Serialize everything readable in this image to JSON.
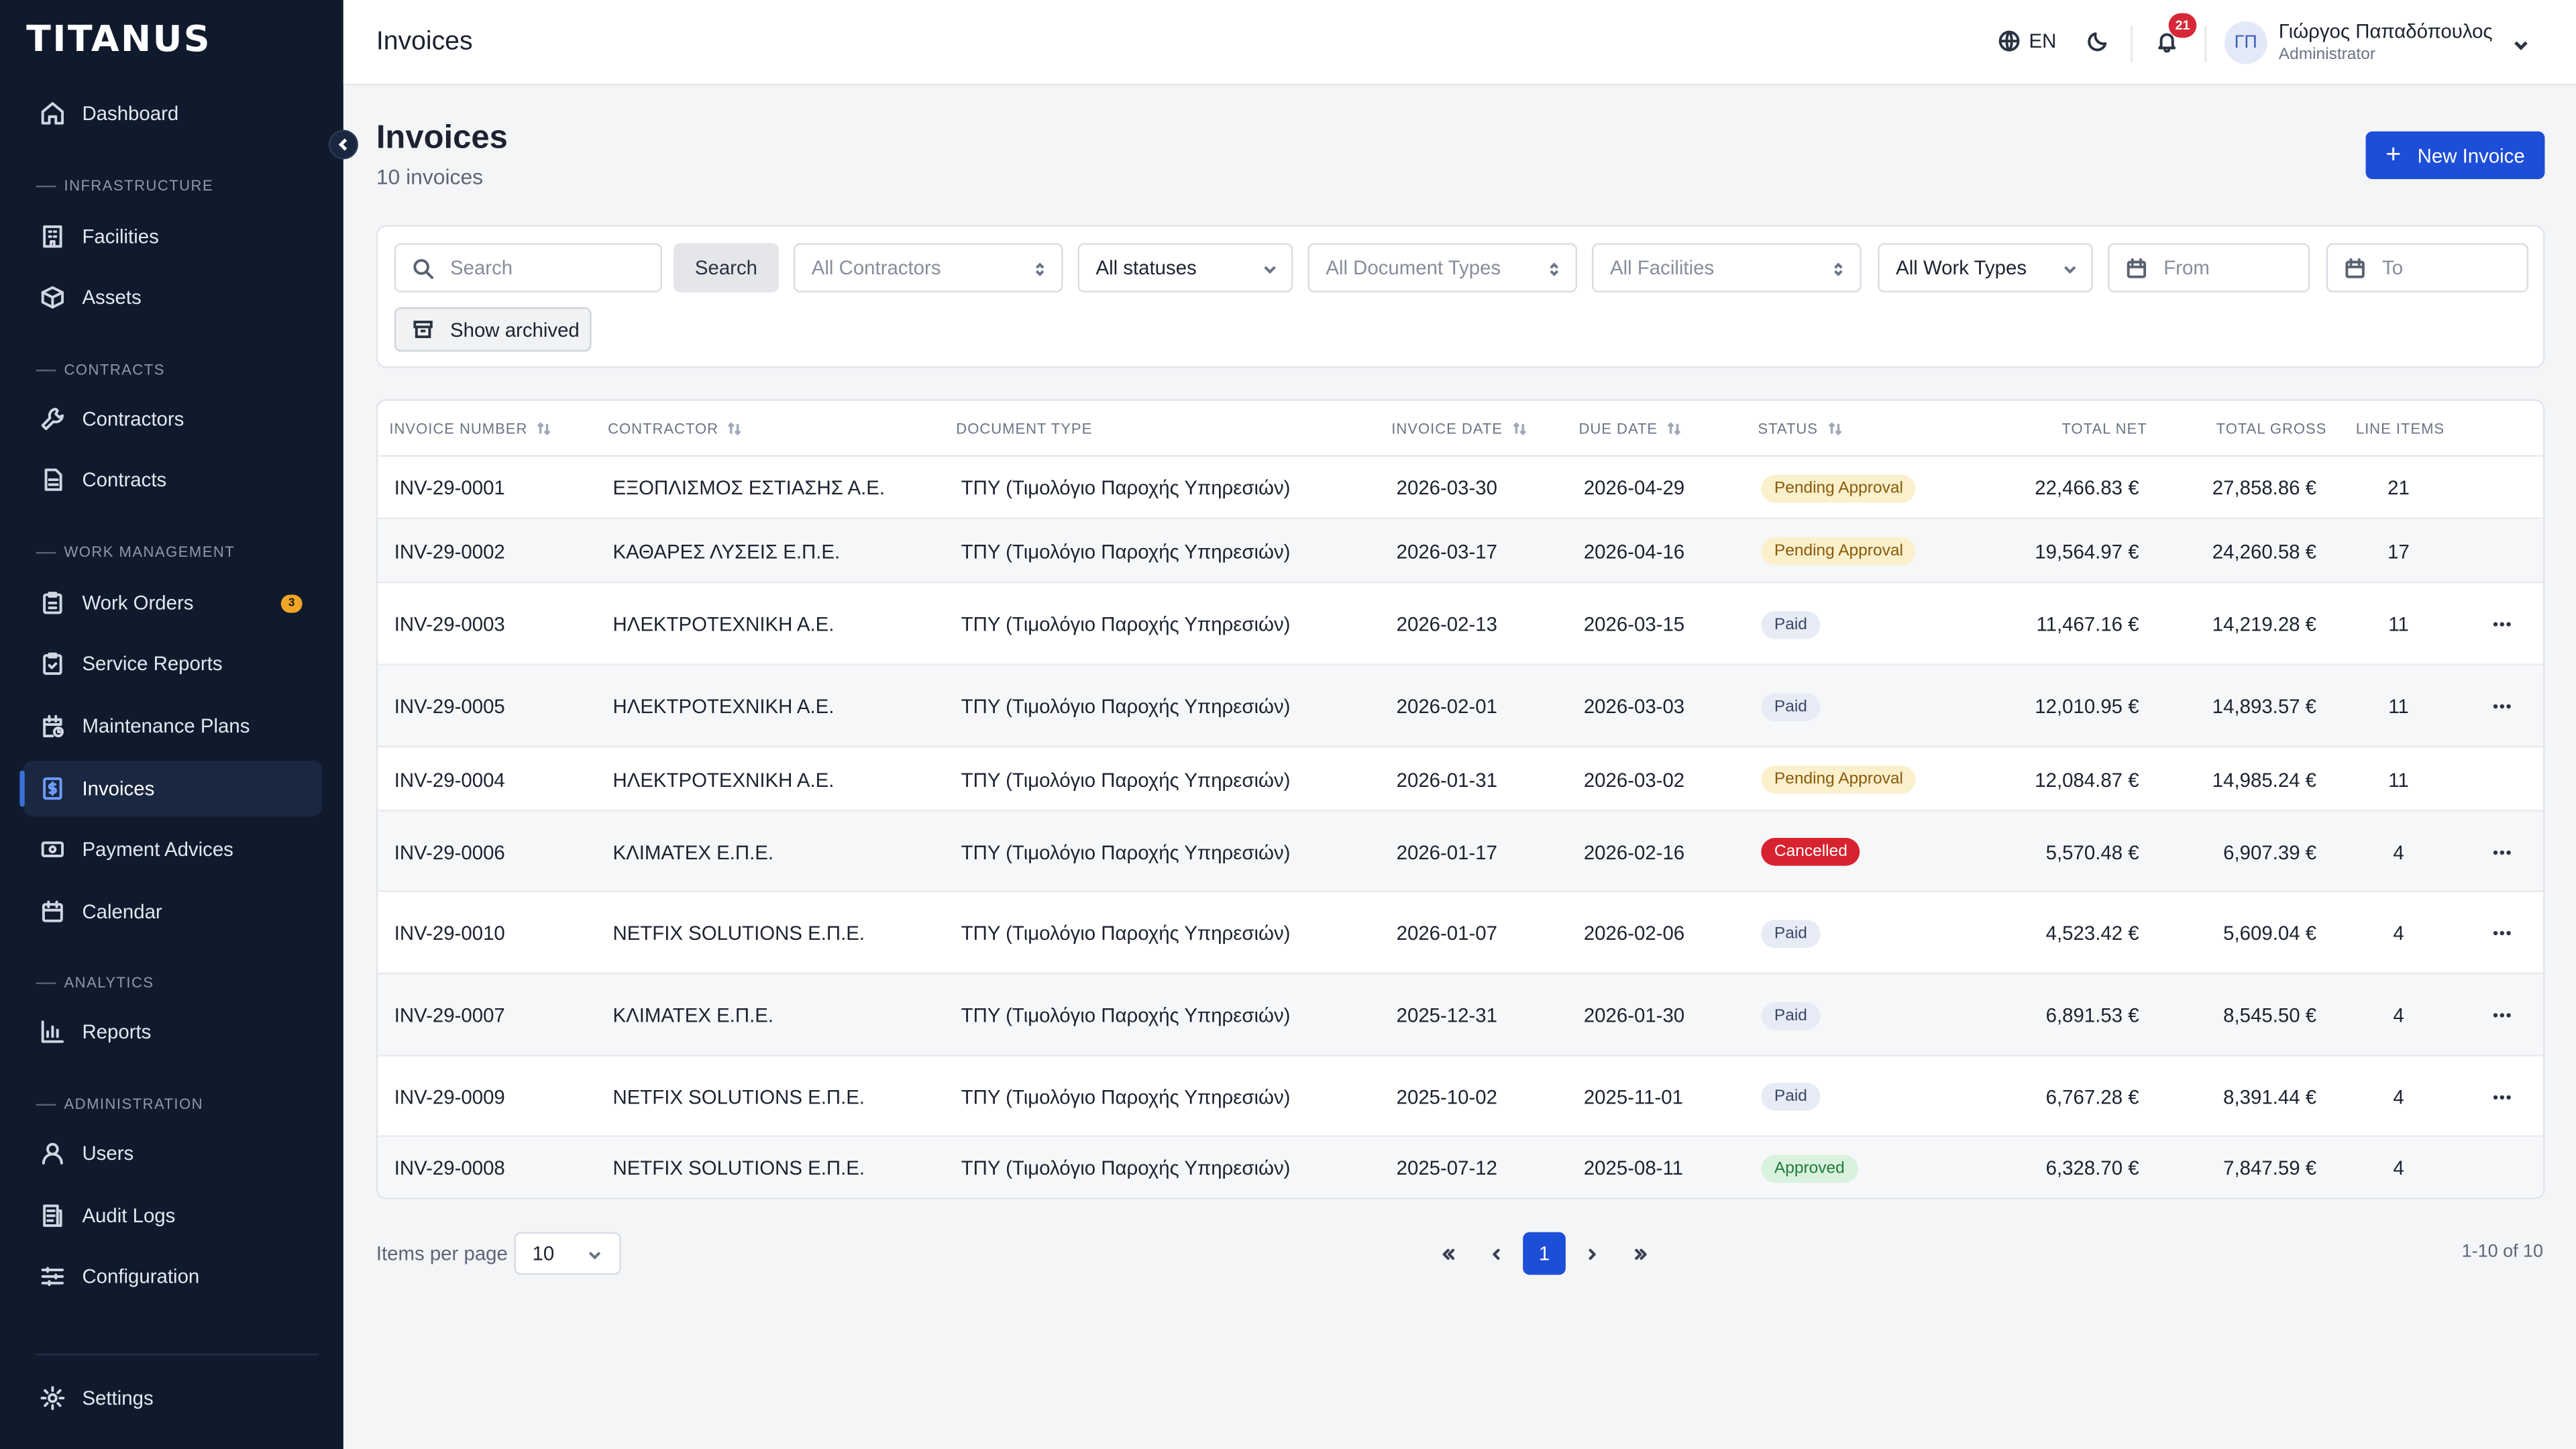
{
  "app": {
    "brand": "TITANUS"
  },
  "sidebar": {
    "items": [
      {
        "label": "Dashboard",
        "icon": "home-icon"
      },
      {
        "section": "INFRASTRUCTURE"
      },
      {
        "label": "Facilities",
        "icon": "building-icon"
      },
      {
        "label": "Assets",
        "icon": "box-icon"
      },
      {
        "section": "CONTRACTS"
      },
      {
        "label": "Contractors",
        "icon": "wrench-icon"
      },
      {
        "label": "Contracts",
        "icon": "document-icon"
      },
      {
        "section": "WORK MANAGEMENT"
      },
      {
        "label": "Work Orders",
        "icon": "clipboard-icon",
        "badge": "3"
      },
      {
        "label": "Service Reports",
        "icon": "clipboard-check-icon"
      },
      {
        "label": "Maintenance Plans",
        "icon": "calendar-clock-icon"
      },
      {
        "label": "Invoices",
        "icon": "invoice-icon",
        "active": true
      },
      {
        "label": "Payment Advices",
        "icon": "banknote-icon"
      },
      {
        "label": "Calendar",
        "icon": "calendar-icon"
      },
      {
        "section": "ANALYTICS"
      },
      {
        "label": "Reports",
        "icon": "bar-chart-icon"
      },
      {
        "section": "ADMINISTRATION"
      },
      {
        "label": "Users",
        "icon": "user-icon"
      },
      {
        "label": "Audit Logs",
        "icon": "logs-icon"
      },
      {
        "label": "Configuration",
        "icon": "sliders-icon"
      },
      {
        "label": "Settings",
        "icon": "gear-icon"
      }
    ]
  },
  "topbar": {
    "title": "Invoices",
    "language": "EN",
    "notifications": "21",
    "user": {
      "initials": "ΓΠ",
      "name": "Γιώργος Παπαδόπουλος",
      "role": "Administrator"
    }
  },
  "header": {
    "title": "Invoices",
    "subtitle": "10 invoices",
    "new_button": "New Invoice"
  },
  "filters": {
    "search_placeholder": "Search",
    "search_button": "Search",
    "contractors": "All Contractors",
    "statuses": "All statuses",
    "document_types": "All Document Types",
    "facilities": "All Facilities",
    "work_types": "All Work Types",
    "from_placeholder": "From",
    "to_placeholder": "To",
    "show_archived": "Show archived"
  },
  "table": {
    "columns": [
      "INVOICE NUMBER",
      "CONTRACTOR",
      "DOCUMENT TYPE",
      "INVOICE DATE",
      "DUE DATE",
      "STATUS",
      "TOTAL NET",
      "TOTAL GROSS",
      "LINE ITEMS"
    ],
    "rows": [
      {
        "number": "INV-29-0001",
        "contractor": "ΕΞΟΠΛΙΣΜΟΣ ΕΣΤΙΑΣΗΣ Α.Ε.",
        "doc_type": "ΤΠΥ (Τιμολόγιο Παροχής Υπηρεσιών)",
        "invoice_date": "2026-03-30",
        "due_date": "2026-04-29",
        "status": "Pending Approval",
        "status_kind": "pending",
        "net": "22,466.83 €",
        "gross": "27,858.86 €",
        "items": "21",
        "menu": false
      },
      {
        "number": "INV-29-0002",
        "contractor": "ΚΑΘΑΡΕΣ ΛΥΣΕΙΣ Ε.Π.Ε.",
        "doc_type": "ΤΠΥ (Τιμολόγιο Παροχής Υπηρεσιών)",
        "invoice_date": "2026-03-17",
        "due_date": "2026-04-16",
        "status": "Pending Approval",
        "status_kind": "pending",
        "net": "19,564.97 €",
        "gross": "24,260.58 €",
        "items": "17",
        "menu": false
      },
      {
        "number": "INV-29-0003",
        "contractor": "ΗΛΕΚΤΡΟΤΕΧΝΙΚΗ Α.Ε.",
        "doc_type": "ΤΠΥ (Τιμολόγιο Παροχής Υπηρεσιών)",
        "invoice_date": "2026-02-13",
        "due_date": "2026-03-15",
        "status": "Paid",
        "status_kind": "paid",
        "net": "11,467.16 €",
        "gross": "14,219.28 €",
        "items": "11",
        "menu": true
      },
      {
        "number": "INV-29-0005",
        "contractor": "ΗΛΕΚΤΡΟΤΕΧΝΙΚΗ Α.Ε.",
        "doc_type": "ΤΠΥ (Τιμολόγιο Παροχής Υπηρεσιών)",
        "invoice_date": "2026-02-01",
        "due_date": "2026-03-03",
        "status": "Paid",
        "status_kind": "paid",
        "net": "12,010.95 €",
        "gross": "14,893.57 €",
        "items": "11",
        "menu": true
      },
      {
        "number": "INV-29-0004",
        "contractor": "ΗΛΕΚΤΡΟΤΕΧΝΙΚΗ Α.Ε.",
        "doc_type": "ΤΠΥ (Τιμολόγιο Παροχής Υπηρεσιών)",
        "invoice_date": "2026-01-31",
        "due_date": "2026-03-02",
        "status": "Pending Approval",
        "status_kind": "pending",
        "net": "12,084.87 €",
        "gross": "14,985.24 €",
        "items": "11",
        "menu": false
      },
      {
        "number": "INV-29-0006",
        "contractor": "ΚΛΙΜΑΤΕΧ Ε.Π.Ε.",
        "doc_type": "ΤΠΥ (Τιμολόγιο Παροχής Υπηρεσιών)",
        "invoice_date": "2026-01-17",
        "due_date": "2026-02-16",
        "status": "Cancelled",
        "status_kind": "cancelled",
        "net": "5,570.48 €",
        "gross": "6,907.39 €",
        "items": "4",
        "menu": true
      },
      {
        "number": "INV-29-0010",
        "contractor": "NETFIX SOLUTIONS Ε.Π.Ε.",
        "doc_type": "ΤΠΥ (Τιμολόγιο Παροχής Υπηρεσιών)",
        "invoice_date": "2026-01-07",
        "due_date": "2026-02-06",
        "status": "Paid",
        "status_kind": "paid",
        "net": "4,523.42 €",
        "gross": "5,609.04 €",
        "items": "4",
        "menu": true
      },
      {
        "number": "INV-29-0007",
        "contractor": "ΚΛΙΜΑΤΕΧ Ε.Π.Ε.",
        "doc_type": "ΤΠΥ (Τιμολόγιο Παροχής Υπηρεσιών)",
        "invoice_date": "2025-12-31",
        "due_date": "2026-01-30",
        "status": "Paid",
        "status_kind": "paid",
        "net": "6,891.53 €",
        "gross": "8,545.50 €",
        "items": "4",
        "menu": true
      },
      {
        "number": "INV-29-0009",
        "contractor": "NETFIX SOLUTIONS Ε.Π.Ε.",
        "doc_type": "ΤΠΥ (Τιμολόγιο Παροχής Υπηρεσιών)",
        "invoice_date": "2025-10-02",
        "due_date": "2025-11-01",
        "status": "Paid",
        "status_kind": "paid",
        "net": "6,767.28 €",
        "gross": "8,391.44 €",
        "items": "4",
        "menu": true
      },
      {
        "number": "INV-29-0008",
        "contractor": "NETFIX SOLUTIONS Ε.Π.Ε.",
        "doc_type": "ΤΠΥ (Τιμολόγιο Παροχής Υπηρεσιών)",
        "invoice_date": "2025-07-12",
        "due_date": "2025-08-11",
        "status": "Approved",
        "status_kind": "approved",
        "net": "6,328.70 €",
        "gross": "7,847.59 €",
        "items": "4",
        "menu": false
      }
    ]
  },
  "pagination": {
    "items_per_page_label": "Items per page",
    "items_per_page": "10",
    "current_page": "1",
    "range": "1-10 of 10"
  },
  "colors": {
    "sidebar_bg": "#0f1a2c",
    "accent": "#1d4ed8",
    "pending": "#fbf0cc",
    "paid": "#e7ebf5",
    "cancelled": "#d72230",
    "approved": "#d9f2de",
    "badge_warning": "#f0a526"
  }
}
